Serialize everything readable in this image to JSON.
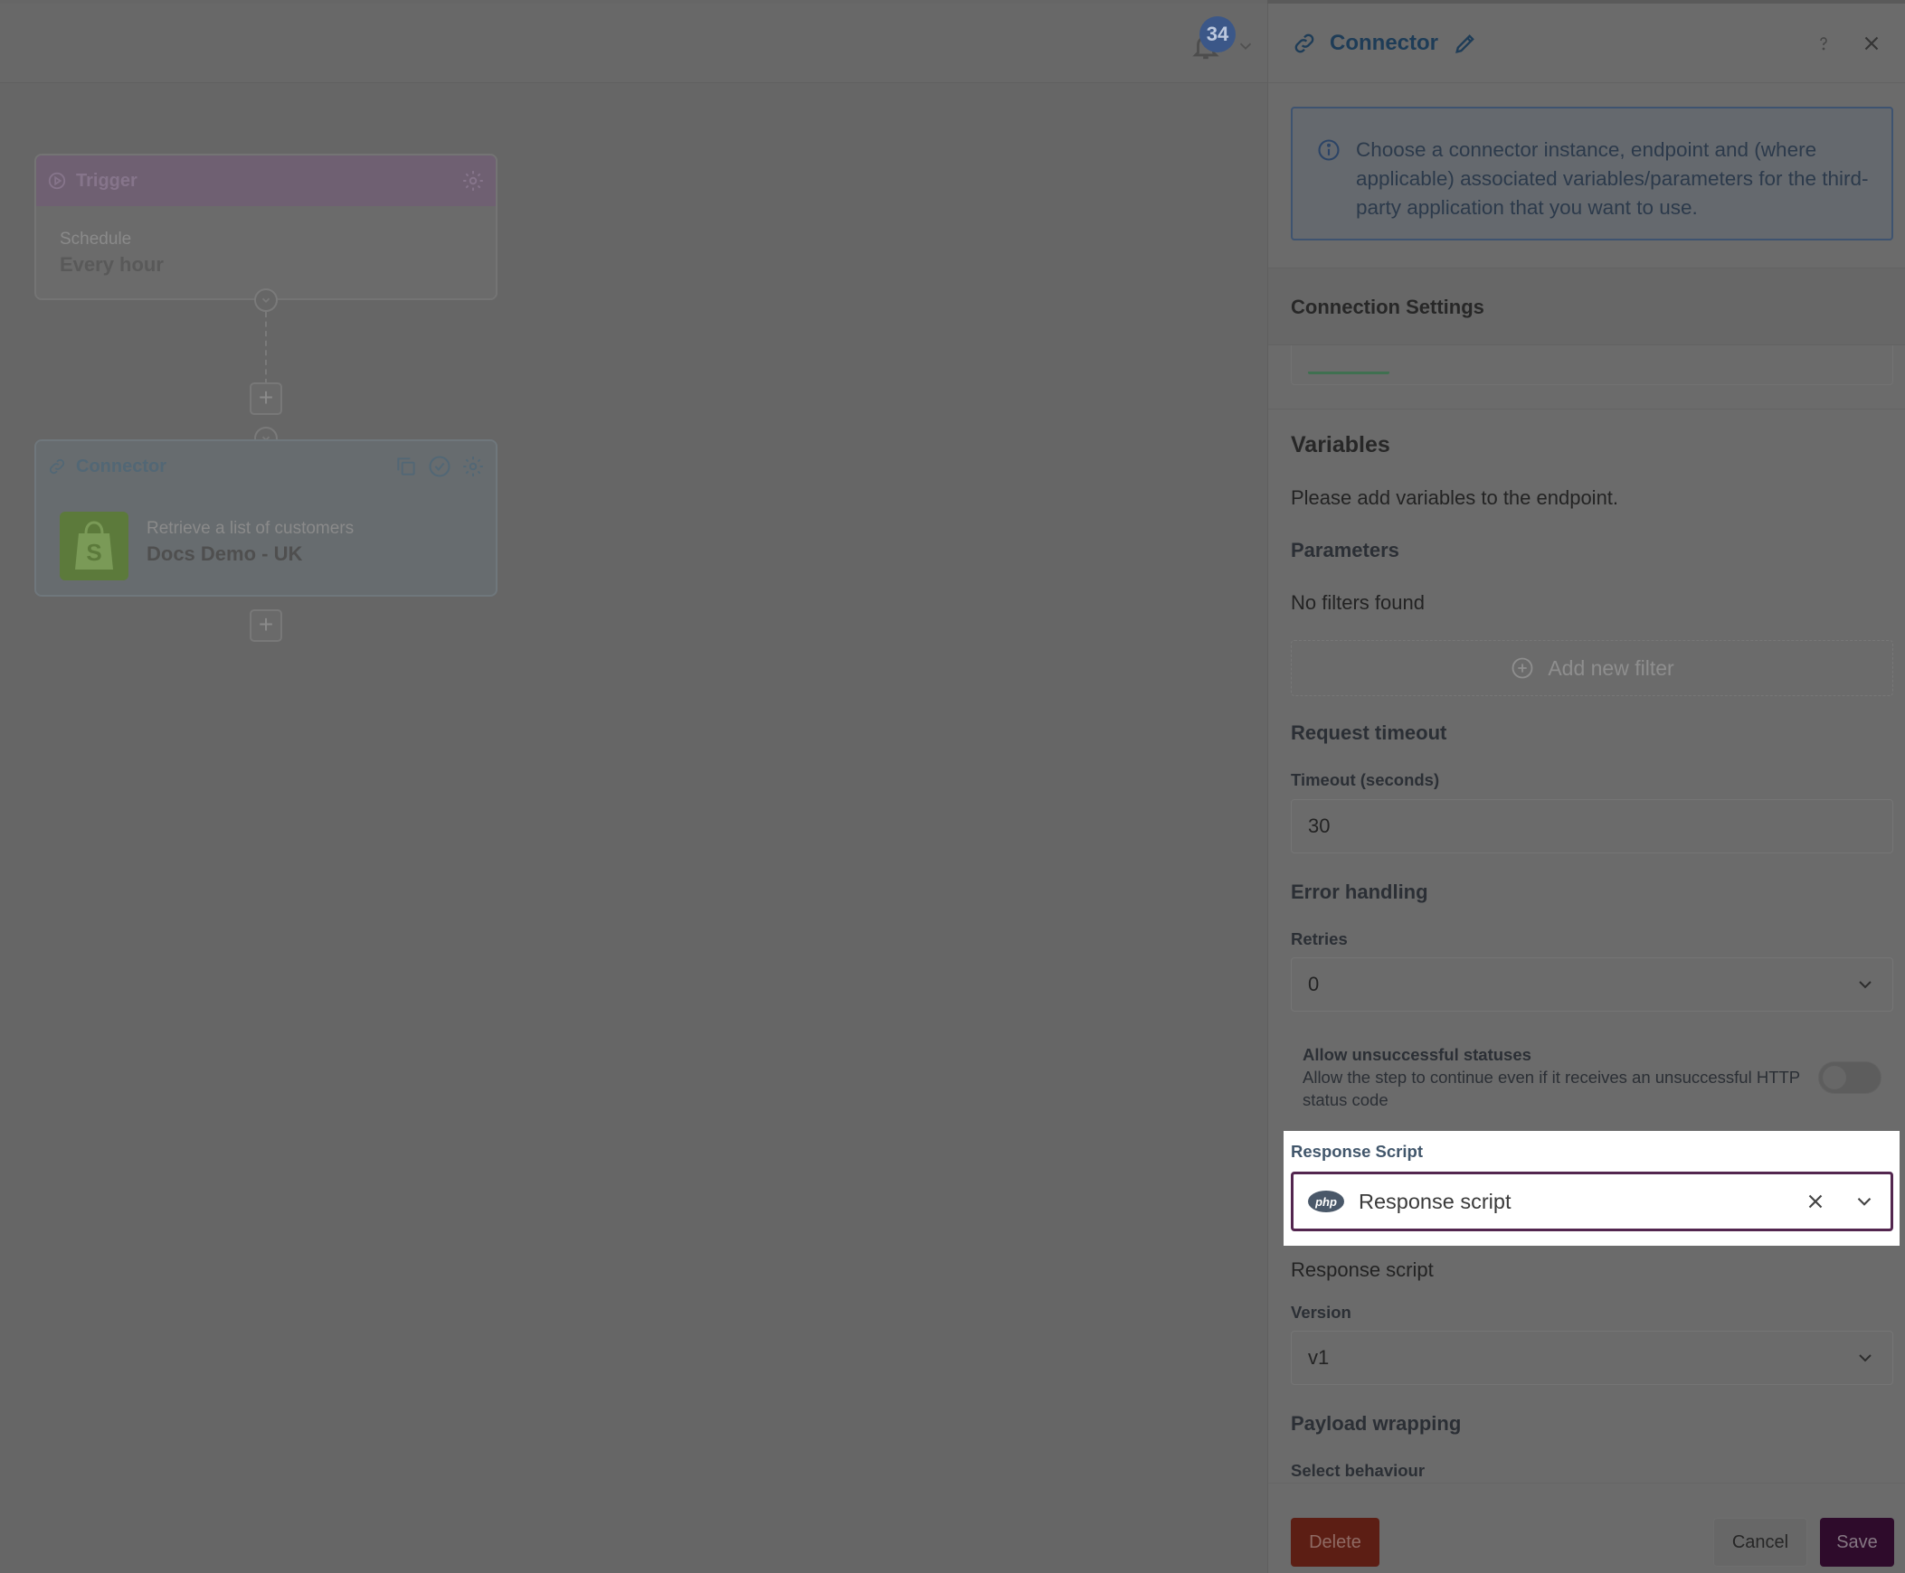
{
  "canvas": {
    "notification_count": "34",
    "trigger": {
      "title": "Trigger",
      "label": "Schedule",
      "value": "Every hour"
    },
    "connector": {
      "title": "Connector",
      "subtitle": "Retrieve a list of customers",
      "name": "Docs Demo - UK"
    }
  },
  "panel": {
    "title": "Connector",
    "info_text": "Choose a connector instance, endpoint and (where applicable) associated variables/parameters for the third-party application that you want to use.",
    "connection_settings": "Connection Settings",
    "variables": {
      "heading": "Variables",
      "text": "Please add variables to the endpoint."
    },
    "parameters": {
      "heading": "Parameters",
      "empty_text": "No filters found",
      "add_filter": "Add new filter"
    },
    "request_timeout": {
      "heading": "Request timeout",
      "label": "Timeout (seconds)",
      "value": "30"
    },
    "error_handling": {
      "heading": "Error handling",
      "retries_label": "Retries",
      "retries_value": "0",
      "allow_title": "Allow unsuccessful statuses",
      "allow_desc": "Allow the step to continue even if it receives an unsuccessful HTTP status code",
      "allow_enabled": false
    },
    "response_script": {
      "label": "Response Script",
      "selected": "Response script",
      "badge": "php",
      "name_text": "Response script",
      "version_label": "Version",
      "version_value": "v1"
    },
    "payload_wrapping": {
      "heading": "Payload wrapping",
      "behaviour_label": "Select behaviour"
    },
    "buttons": {
      "delete": "Delete",
      "cancel": "Cancel",
      "save": "Save"
    },
    "colors": {
      "highlight_border": "#53264f",
      "save_bg": "#2e0b2b",
      "delete_bg": "#5c1e14"
    }
  }
}
